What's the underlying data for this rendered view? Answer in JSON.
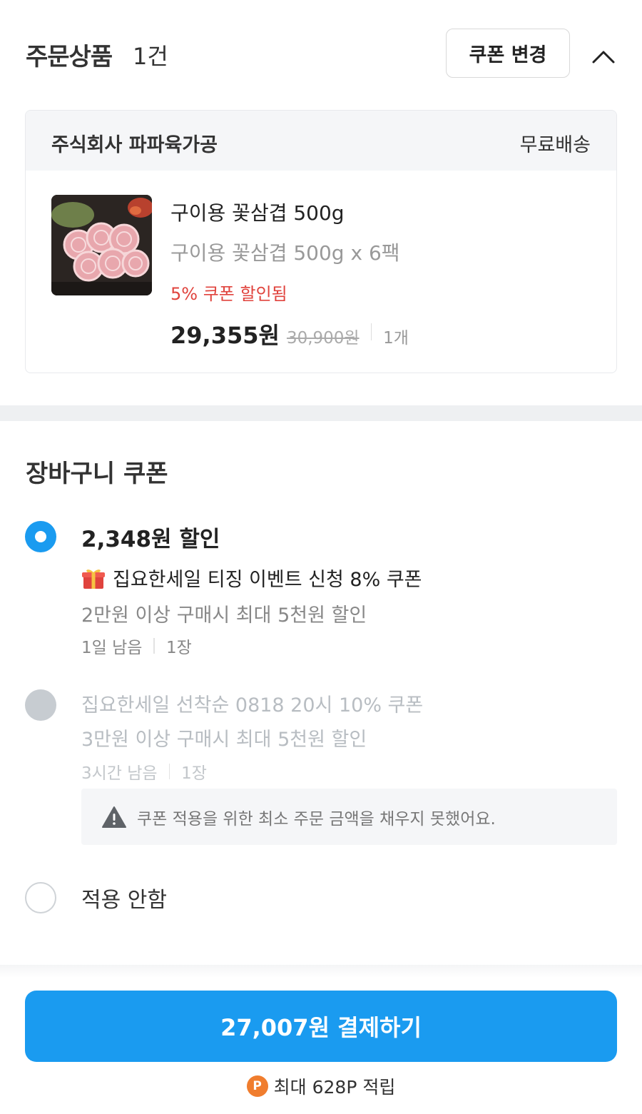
{
  "order": {
    "title": "주문상품",
    "count": "1건",
    "coupon_change_label": "쿠폰 변경"
  },
  "product_card": {
    "seller": "주식회사 파파육가공",
    "shipping": "무료배송",
    "name": "구이용 꽃삼겹 500g",
    "option": "구이용 꽃삼겹 500g x 6팩",
    "discount_note": "5% 쿠폰 할인됨",
    "price": "29,355원",
    "original_price": "30,900원",
    "quantity": "1개"
  },
  "coupons": {
    "section_title": "장바구니 쿠폰",
    "items": [
      {
        "amount": "2,348원 할인",
        "name": "집요한세일 티징 이벤트 신청 8% 쿠폰",
        "condition": "2만원 이상 구매시 최대 5천원 할인",
        "remaining": "1일 남음",
        "qty": "1장",
        "state": "selected",
        "icon": "gift-icon"
      },
      {
        "name": "집요한세일 선착순 0818 20시 10% 쿠폰",
        "condition": "3만원 이상 구매시 최대 5천원 할인",
        "remaining": "3시간 남음",
        "qty": "1장",
        "state": "disabled",
        "warning": "쿠폰 적용을 위한 최소 주문 금액을 채우지 못했어요."
      }
    ],
    "none_label": "적용 안함"
  },
  "footer": {
    "pay_label": "27,007원 결제하기",
    "points_badge": "P",
    "points_text": "최대 628P 적립"
  },
  "colors": {
    "accent": "#1a9bf0",
    "discount_red": "#e0433d",
    "points_orange": "#f07d2e"
  }
}
